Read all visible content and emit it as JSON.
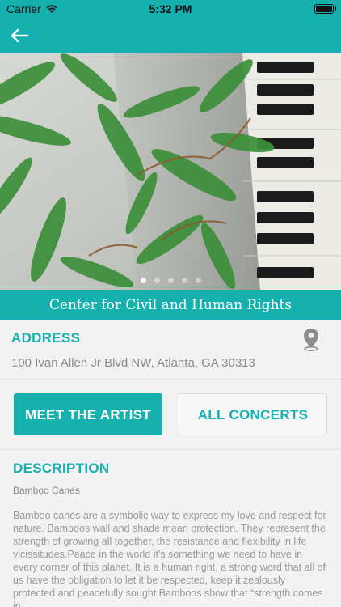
{
  "status_bar": {
    "carrier": "Carrier",
    "time": "5:32 PM",
    "wifi_icon": "wifi-icon",
    "battery_icon": "battery-icon"
  },
  "nav": {
    "back_icon": "back-arrow-icon",
    "accent_color": "#16b0ae"
  },
  "hero": {
    "carousel_index": 1,
    "carousel_count": 5
  },
  "venue": {
    "name": "Center for Civil and Human Rights"
  },
  "address": {
    "heading": "ADDRESS",
    "value": "100 Ivan Allen Jr Blvd NW, Atlanta, GA 30313",
    "icon": "location-pin-icon"
  },
  "buttons": {
    "meet_artist": "MEET THE ARTIST",
    "all_concerts": "ALL CONCERTS"
  },
  "description": {
    "heading": "DESCRIPTION",
    "subtitle": "Bamboo Canes",
    "body": "Bamboo canes are a symbolic way to express my love and respect for nature. Bamboos wall and shade mean protection. They represent the strength of growing all together, the resistance and flexibility in life vicissitudes.Peace in the world it's something we need to have in every corner of this planet. It is a human right, a strong word that all of us have the obligation to let it be respected, keep it zealously protected and peacefully sought.Bamboos show that “strength comes in"
  }
}
